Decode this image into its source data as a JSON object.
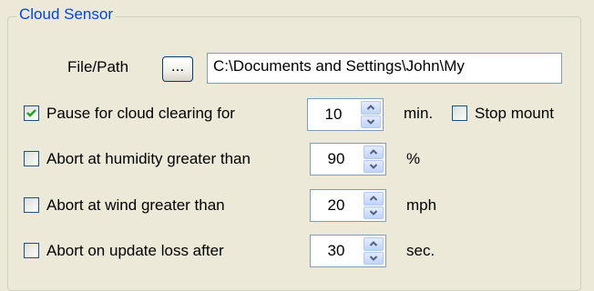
{
  "group": {
    "title": "Cloud Sensor"
  },
  "file_path": {
    "label": "File/Path",
    "browse_label": "...",
    "value": "C:\\Documents and Settings\\John\\My"
  },
  "rows": [
    {
      "label": "Pause for cloud clearing for",
      "checked": true,
      "value": "10",
      "unit": "min."
    },
    {
      "label": "Abort at humidity greater than",
      "checked": false,
      "value": "90",
      "unit": "%"
    },
    {
      "label": "Abort at wind greater than",
      "checked": false,
      "value": "20",
      "unit": "mph"
    },
    {
      "label": "Abort on update loss after",
      "checked": false,
      "value": "30",
      "unit": "sec."
    }
  ],
  "stop_mount": {
    "label": "Stop mount",
    "checked": false
  },
  "icons": {
    "spin_up": "chevron-up-icon",
    "spin_down": "chevron-down-icon",
    "check": "check-icon"
  },
  "colors": {
    "accent": "#0046D5",
    "check": "#21A121",
    "background": "#ECE9D8"
  }
}
